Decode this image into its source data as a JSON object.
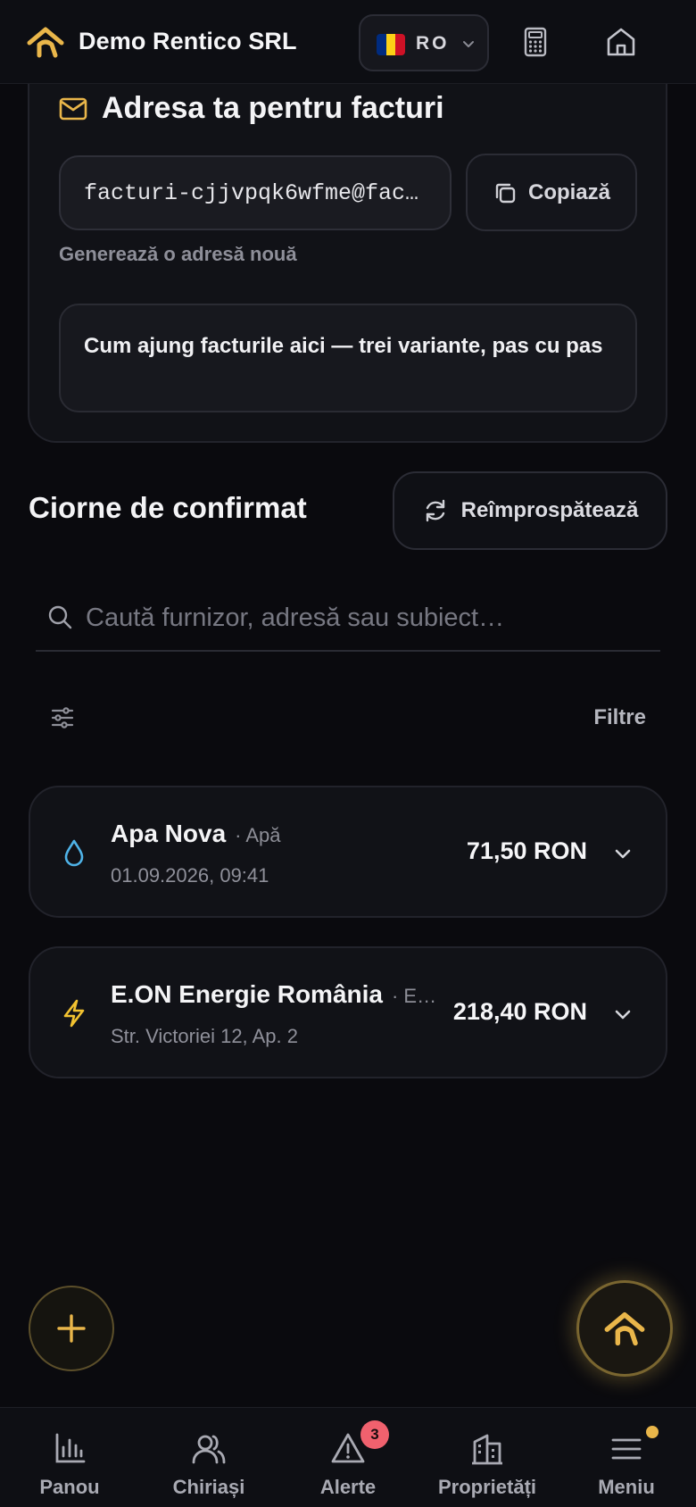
{
  "header": {
    "company": "Demo Rentico SRL",
    "language_code": "RO",
    "flag_colors": [
      "#002B7F",
      "#FCD116",
      "#CE1126"
    ],
    "brand_color": "#E9B64A"
  },
  "invoice_address": {
    "title": "Adresa ta pentru facturi",
    "email_value": "facturi-cjjvpqk6wfme@fac…",
    "copy_label": "Copiază",
    "generate_label": "Generează o adresă nouă",
    "howto_label": "Cum ajung facturile aici — trei variante, pas cu pas"
  },
  "drafts": {
    "title": "Ciorne de confirmat",
    "refresh_label": "Reîmprospătează",
    "search_placeholder": "Caută furnizor, adresă sau subiect…",
    "filter_label": "Filtre",
    "items": [
      {
        "supplier": "Apa Nova",
        "category": "· Apă",
        "subtitle": "01.09.2026, 09:41",
        "amount": "71,50 RON",
        "icon": "water-drop-icon",
        "icon_color": "#4FB3E8"
      },
      {
        "supplier": "E.ON Energie România",
        "category": "· E…",
        "subtitle": "Str. Victoriei 12, Ap. 2",
        "amount": "218,40 RON",
        "icon": "lightning-icon",
        "icon_color": "#F2C230"
      }
    ]
  },
  "nav": {
    "items": [
      {
        "label": "Panou",
        "icon": "chart-icon"
      },
      {
        "label": "Chiriași",
        "icon": "users-icon"
      },
      {
        "label": "Alerte",
        "icon": "alert-icon",
        "badge": "3"
      },
      {
        "label": "Proprietăți",
        "icon": "building-icon"
      },
      {
        "label": "Meniu",
        "icon": "menu-icon"
      }
    ]
  }
}
